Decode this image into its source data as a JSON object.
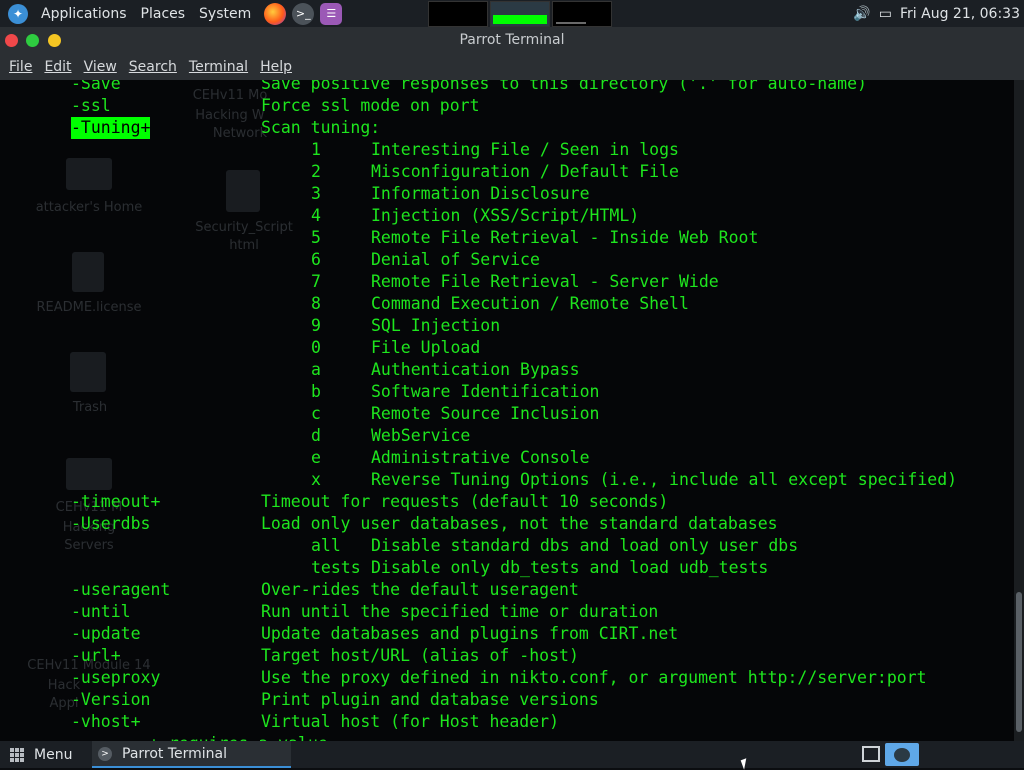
{
  "top_panel": {
    "applications_label": "Applications",
    "places_label": "Places",
    "system_label": "System",
    "datetime": "Fri Aug 21, 06:33",
    "icons": [
      "parrot-logo-icon",
      "firefox-icon",
      "terminal-icon",
      "notes-icon",
      "volume-icon",
      "display-icon"
    ]
  },
  "window": {
    "title": "Parrot Terminal",
    "menu": [
      "File",
      "Edit",
      "View",
      "Search",
      "Terminal",
      "Help"
    ]
  },
  "desktop_ghost": [
    "CEHv11 Mo",
    "Hacking W",
    "Network",
    "attacker's Home",
    "Security_Script",
    "html",
    "README.license",
    "Trash",
    "CEHv11 M",
    "Hacking",
    "Servers",
    "CEHv11 Module 14",
    "Hack",
    "Appl"
  ],
  "terminal": {
    "lines": [
      {
        "opt": "-Save",
        "desc": "Save positive responses to this directory ('.' for auto-name)"
      },
      {
        "opt": "-ssl",
        "desc": "Force ssl mode on port"
      },
      {
        "opt": "-Tuning+",
        "desc": "Scan tuning:",
        "highlight": true
      },
      {
        "code": "1",
        "cdesc": "Interesting File / Seen in logs"
      },
      {
        "code": "2",
        "cdesc": "Misconfiguration / Default File"
      },
      {
        "code": "3",
        "cdesc": "Information Disclosure"
      },
      {
        "code": "4",
        "cdesc": "Injection (XSS/Script/HTML)"
      },
      {
        "code": "5",
        "cdesc": "Remote File Retrieval - Inside Web Root"
      },
      {
        "code": "6",
        "cdesc": "Denial of Service"
      },
      {
        "code": "7",
        "cdesc": "Remote File Retrieval - Server Wide"
      },
      {
        "code": "8",
        "cdesc": "Command Execution / Remote Shell"
      },
      {
        "code": "9",
        "cdesc": "SQL Injection"
      },
      {
        "code": "0",
        "cdesc": "File Upload"
      },
      {
        "code": "a",
        "cdesc": "Authentication Bypass"
      },
      {
        "code": "b",
        "cdesc": "Software Identification"
      },
      {
        "code": "c",
        "cdesc": "Remote Source Inclusion"
      },
      {
        "code": "d",
        "cdesc": "WebService"
      },
      {
        "code": "e",
        "cdesc": "Administrative Console"
      },
      {
        "code": "x",
        "cdesc": "Reverse Tuning Options (i.e., include all except specified)"
      },
      {
        "opt": "-timeout+",
        "desc": "Timeout for requests (default 10 seconds)"
      },
      {
        "opt": "-Userdbs",
        "desc": "Load only user databases, not the standard databases"
      },
      {
        "code": "all",
        "cdesc": "Disable standard dbs and load only user dbs"
      },
      {
        "code": "tests",
        "cdesc": "Disable only db_tests and load udb_tests"
      },
      {
        "opt": "-useragent",
        "desc": "Over-rides the default useragent"
      },
      {
        "opt": "-until",
        "desc": "Run until the specified time or duration"
      },
      {
        "opt": "-update",
        "desc": "Update databases and plugins from CIRT.net"
      },
      {
        "opt": "-url+",
        "desc": "Target host/URL (alias of -host)"
      },
      {
        "opt": "-useproxy",
        "desc": "Use the proxy defined in nikto.conf, or argument http://server:port"
      },
      {
        "opt": "-Version",
        "desc": "Print plugin and database versions"
      },
      {
        "opt": "-vhost+",
        "desc": "Virtual host (for Host header)"
      },
      {
        "full": "               + requires a value"
      }
    ]
  },
  "bottom_panel": {
    "menu_label": "Menu",
    "task_label": "Parrot Terminal"
  },
  "colors": {
    "terminal_text": "#1ee61e",
    "highlight_bg": "#00ff00",
    "panel_bg": "#1b1f24"
  }
}
